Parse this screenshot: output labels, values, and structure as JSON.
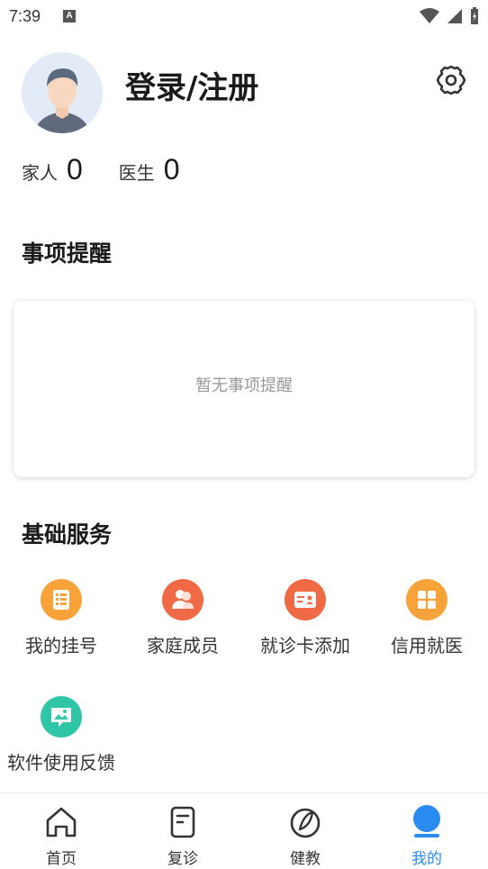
{
  "status_bar": {
    "time": "7:39",
    "badge": "A"
  },
  "profile": {
    "login_label": "登录/注册"
  },
  "stats": [
    {
      "label": "家人",
      "value": "0"
    },
    {
      "label": "医生",
      "value": "0"
    }
  ],
  "reminders": {
    "title": "事项提醒",
    "empty_text": "暂无事项提醒"
  },
  "services": {
    "title": "基础服务",
    "items": [
      {
        "label": "我的挂号",
        "icon": "list-icon",
        "color": "#f7a33a"
      },
      {
        "label": "家庭成员",
        "icon": "people-icon",
        "color": "#f06a45"
      },
      {
        "label": "就诊卡添加",
        "icon": "card-icon",
        "color": "#f06a45"
      },
      {
        "label": "信用就医",
        "icon": "grid-icon",
        "color": "#f7a33a"
      },
      {
        "label": "软件使用反馈",
        "icon": "feedback-icon",
        "color": "#2fc6a8"
      }
    ]
  },
  "tabs": [
    {
      "label": "首页",
      "icon": "home-icon",
      "active": false
    },
    {
      "label": "复诊",
      "icon": "revisit-icon",
      "active": false
    },
    {
      "label": "健教",
      "icon": "health-icon",
      "active": false
    },
    {
      "label": "我的",
      "icon": "profile-icon",
      "active": true
    }
  ],
  "colors": {
    "accent": "#2a8cf0"
  }
}
